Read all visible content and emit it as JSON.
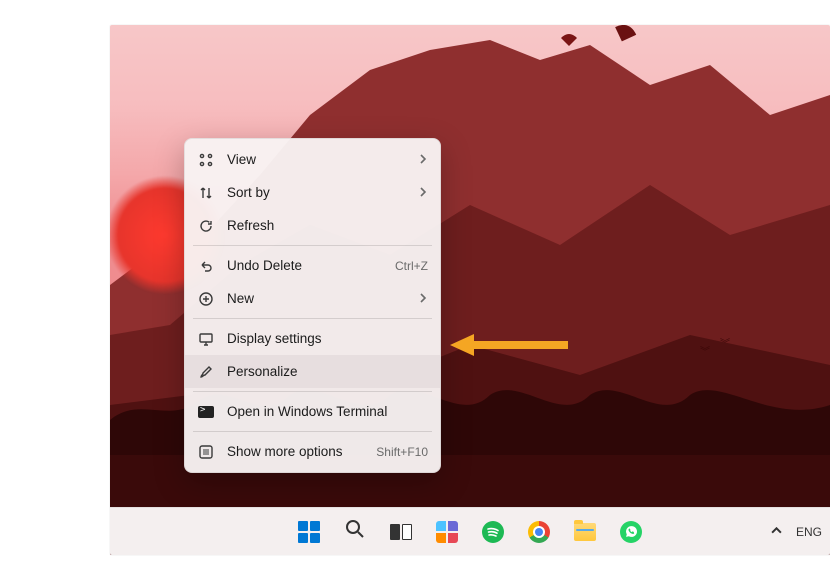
{
  "context_menu": {
    "groups": [
      [
        {
          "icon": "grid-icon",
          "label": "View",
          "submenu": true
        },
        {
          "icon": "sort-icon",
          "label": "Sort by",
          "submenu": true
        },
        {
          "icon": "refresh-icon",
          "label": "Refresh"
        }
      ],
      [
        {
          "icon": "undo-icon",
          "label": "Undo Delete",
          "accelerator": "Ctrl+Z"
        },
        {
          "icon": "plus-icon",
          "label": "New",
          "submenu": true
        }
      ],
      [
        {
          "icon": "display-icon",
          "label": "Display settings"
        },
        {
          "icon": "brush-icon",
          "label": "Personalize",
          "highlighted": true
        }
      ],
      [
        {
          "icon": "terminal-icon",
          "label": "Open in Windows Terminal"
        }
      ],
      [
        {
          "icon": "more-icon",
          "label": "Show more options",
          "accelerator": "Shift+F10"
        }
      ]
    ]
  },
  "annotation": {
    "arrow_color": "#f5a623",
    "target": "Personalize"
  },
  "taskbar": {
    "pinned": [
      {
        "name": "start",
        "tooltip": "Start"
      },
      {
        "name": "search",
        "tooltip": "Search"
      },
      {
        "name": "task-view",
        "tooltip": "Task view"
      },
      {
        "name": "widgets",
        "tooltip": "Widgets"
      },
      {
        "name": "spotify",
        "tooltip": "Spotify"
      },
      {
        "name": "chrome",
        "tooltip": "Google Chrome"
      },
      {
        "name": "file-explorer",
        "tooltip": "File Explorer"
      },
      {
        "name": "whatsapp",
        "tooltip": "WhatsApp"
      }
    ],
    "tray": {
      "overflow": "^",
      "language": "ENG"
    }
  }
}
